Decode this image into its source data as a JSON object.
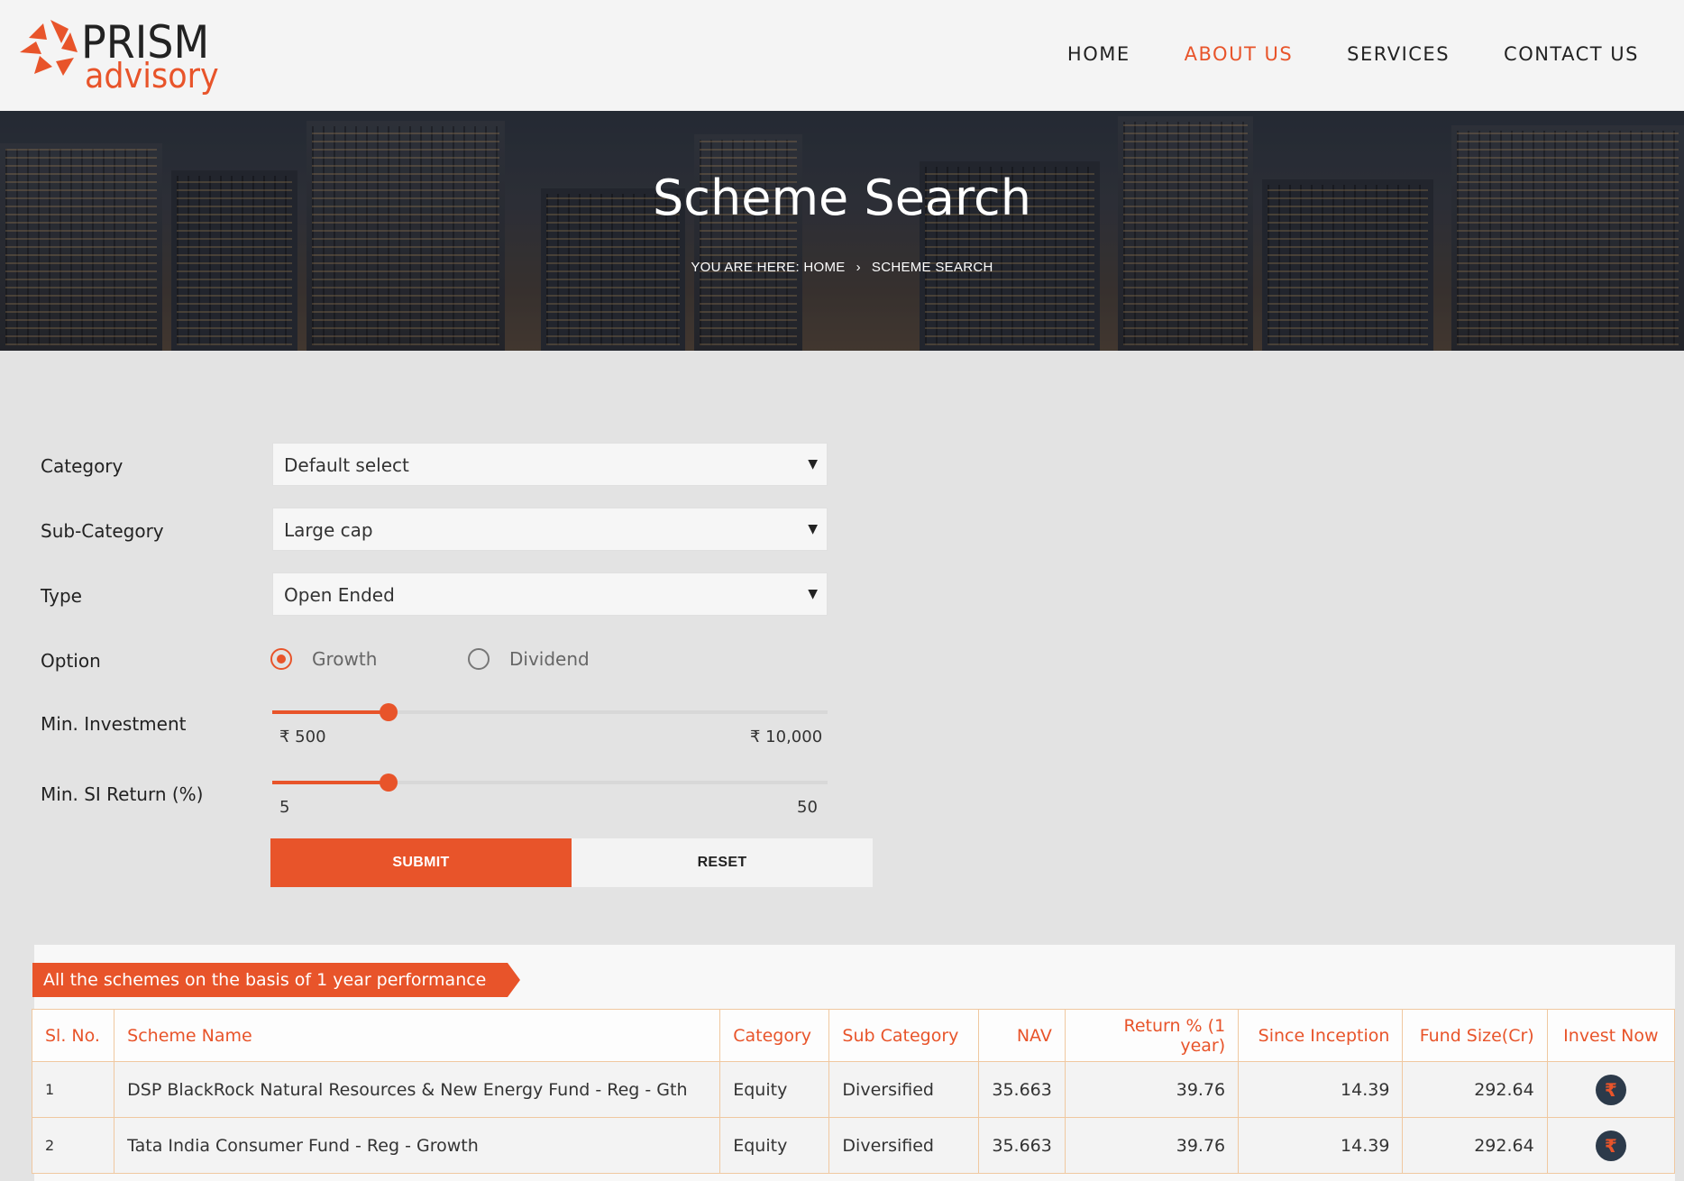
{
  "brand": {
    "word1": "PRISM",
    "word2": "advisory"
  },
  "nav": [
    {
      "label": "HOME"
    },
    {
      "label": "ABOUT US"
    },
    {
      "label": "SERVICES"
    },
    {
      "label": "CONTACT US"
    }
  ],
  "colors": {
    "accent": "#e8542a",
    "invest_icon_bg": "#2c3a4a"
  },
  "hero": {
    "title": "Scheme Search",
    "breadcrumb_prefix": "YOU ARE HERE: HOME",
    "breadcrumb_sep": "›",
    "breadcrumb_current": "SCHEME SEARCH"
  },
  "form": {
    "category": {
      "label": "Category",
      "value": "Default select"
    },
    "subcategory": {
      "label": "Sub-Category",
      "value": "Large cap"
    },
    "type": {
      "label": "Type",
      "value": "Open Ended"
    },
    "option": {
      "label": "Option",
      "growth": "Growth",
      "dividend": "Dividend",
      "selected": "Growth"
    },
    "min_investment": {
      "label": "Min. Investment",
      "min": "₹ 500",
      "max": "₹ 10,000",
      "level": 0.21
    },
    "min_si_return": {
      "label": "Min. SI Return (%)",
      "min": "5",
      "max": "50",
      "level": 0.21
    },
    "submit": "SUBMIT",
    "reset": "RESET"
  },
  "results": {
    "ribbon": "All the schemes on the basis of 1 year performance",
    "headers": [
      "Sl. No.",
      "Scheme Name",
      "Category",
      "Sub Category",
      "NAV",
      "Return % (1 year)",
      "Since Inception",
      "Fund Size(Cr)",
      "Invest Now"
    ],
    "rows": [
      {
        "sl": "1",
        "name": "DSP BlackRock Natural Resources & New Energy Fund - Reg - Gth",
        "category": "Equity",
        "subcategory": "Diversified",
        "nav": "35.663",
        "return": "39.76",
        "inception": "14.39",
        "fund_size": "292.64"
      },
      {
        "sl": "2",
        "name": "Tata India Consumer Fund - Reg - Growth",
        "category": "Equity",
        "subcategory": "Diversified",
        "nav": "35.663",
        "return": "39.76",
        "inception": "14.39",
        "fund_size": "292.64"
      }
    ],
    "invest_icon": "rupee-icon"
  }
}
